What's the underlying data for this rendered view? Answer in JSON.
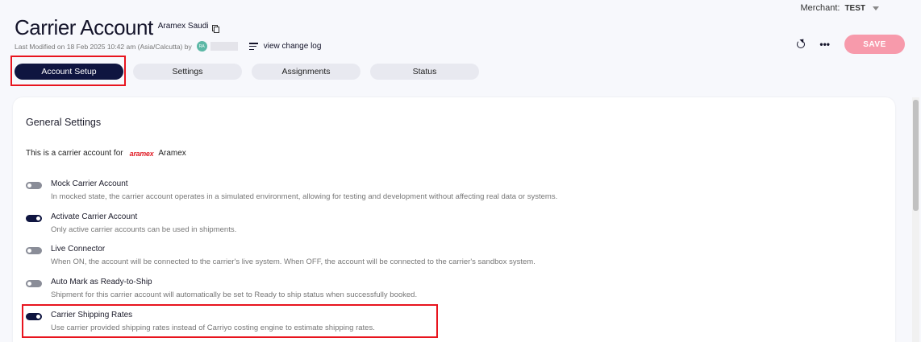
{
  "header": {
    "merchant_label": "Merchant:",
    "merchant_value": "TEST",
    "title": "Carrier Account",
    "subtitle": "Aramex Saudi",
    "last_modified": "Last Modified on 18 Feb 2025 10:42 am (Asia/Calcutta) by",
    "avatar_initials": "RA",
    "change_log_label": "view change log",
    "save_label": "SAVE",
    "more_label": "•••"
  },
  "tabs": [
    {
      "label": "Account Setup",
      "active": true
    },
    {
      "label": "Settings",
      "active": false
    },
    {
      "label": "Assignments",
      "active": false
    },
    {
      "label": "Status",
      "active": false
    }
  ],
  "general": {
    "title": "General Settings",
    "carrier_text": "This is a carrier account for",
    "carrier_logo": "aramex",
    "carrier_name": "Aramex"
  },
  "settings": [
    {
      "label": "Mock Carrier Account",
      "desc": "In mocked state, the carrier account operates in a simulated environment, allowing for testing and development without affecting real data or systems.",
      "on": false
    },
    {
      "label": "Activate Carrier Account",
      "desc": "Only active carrier accounts can be used in shipments.",
      "on": true
    },
    {
      "label": "Live Connector",
      "desc": "When ON, the account will be connected to the carrier's live system. When OFF, the account will be connected to the carrier's sandbox system.",
      "on": false
    },
    {
      "label": "Auto Mark as Ready-to-Ship",
      "desc": "Shipment for this carrier account will automatically be set to Ready to ship status when successfully booked.",
      "on": false
    },
    {
      "label": "Carrier Shipping Rates",
      "desc": "Use carrier provided shipping rates instead of Carriyo costing engine to estimate shipping rates.",
      "on": true
    }
  ],
  "colors": {
    "accent": "#0f1540",
    "save": "#f79aab",
    "highlight": "#e8141e",
    "brand": "#e1222b"
  }
}
